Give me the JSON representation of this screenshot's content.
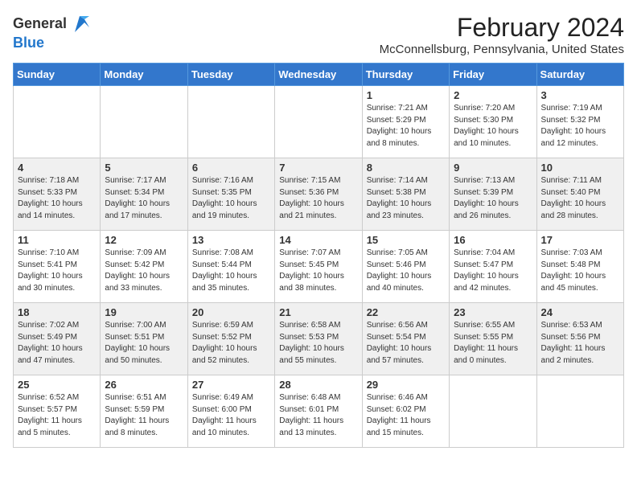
{
  "header": {
    "logo_general": "General",
    "logo_blue": "Blue",
    "month_title": "February 2024",
    "location": "McConnellsburg, Pennsylvania, United States"
  },
  "calendar": {
    "days_of_week": [
      "Sunday",
      "Monday",
      "Tuesday",
      "Wednesday",
      "Thursday",
      "Friday",
      "Saturday"
    ],
    "weeks": [
      [
        {
          "day": "",
          "info": ""
        },
        {
          "day": "",
          "info": ""
        },
        {
          "day": "",
          "info": ""
        },
        {
          "day": "",
          "info": ""
        },
        {
          "day": "1",
          "info": "Sunrise: 7:21 AM\nSunset: 5:29 PM\nDaylight: 10 hours\nand 8 minutes."
        },
        {
          "day": "2",
          "info": "Sunrise: 7:20 AM\nSunset: 5:30 PM\nDaylight: 10 hours\nand 10 minutes."
        },
        {
          "day": "3",
          "info": "Sunrise: 7:19 AM\nSunset: 5:32 PM\nDaylight: 10 hours\nand 12 minutes."
        }
      ],
      [
        {
          "day": "4",
          "info": "Sunrise: 7:18 AM\nSunset: 5:33 PM\nDaylight: 10 hours\nand 14 minutes."
        },
        {
          "day": "5",
          "info": "Sunrise: 7:17 AM\nSunset: 5:34 PM\nDaylight: 10 hours\nand 17 minutes."
        },
        {
          "day": "6",
          "info": "Sunrise: 7:16 AM\nSunset: 5:35 PM\nDaylight: 10 hours\nand 19 minutes."
        },
        {
          "day": "7",
          "info": "Sunrise: 7:15 AM\nSunset: 5:36 PM\nDaylight: 10 hours\nand 21 minutes."
        },
        {
          "day": "8",
          "info": "Sunrise: 7:14 AM\nSunset: 5:38 PM\nDaylight: 10 hours\nand 23 minutes."
        },
        {
          "day": "9",
          "info": "Sunrise: 7:13 AM\nSunset: 5:39 PM\nDaylight: 10 hours\nand 26 minutes."
        },
        {
          "day": "10",
          "info": "Sunrise: 7:11 AM\nSunset: 5:40 PM\nDaylight: 10 hours\nand 28 minutes."
        }
      ],
      [
        {
          "day": "11",
          "info": "Sunrise: 7:10 AM\nSunset: 5:41 PM\nDaylight: 10 hours\nand 30 minutes."
        },
        {
          "day": "12",
          "info": "Sunrise: 7:09 AM\nSunset: 5:42 PM\nDaylight: 10 hours\nand 33 minutes."
        },
        {
          "day": "13",
          "info": "Sunrise: 7:08 AM\nSunset: 5:44 PM\nDaylight: 10 hours\nand 35 minutes."
        },
        {
          "day": "14",
          "info": "Sunrise: 7:07 AM\nSunset: 5:45 PM\nDaylight: 10 hours\nand 38 minutes."
        },
        {
          "day": "15",
          "info": "Sunrise: 7:05 AM\nSunset: 5:46 PM\nDaylight: 10 hours\nand 40 minutes."
        },
        {
          "day": "16",
          "info": "Sunrise: 7:04 AM\nSunset: 5:47 PM\nDaylight: 10 hours\nand 42 minutes."
        },
        {
          "day": "17",
          "info": "Sunrise: 7:03 AM\nSunset: 5:48 PM\nDaylight: 10 hours\nand 45 minutes."
        }
      ],
      [
        {
          "day": "18",
          "info": "Sunrise: 7:02 AM\nSunset: 5:49 PM\nDaylight: 10 hours\nand 47 minutes."
        },
        {
          "day": "19",
          "info": "Sunrise: 7:00 AM\nSunset: 5:51 PM\nDaylight: 10 hours\nand 50 minutes."
        },
        {
          "day": "20",
          "info": "Sunrise: 6:59 AM\nSunset: 5:52 PM\nDaylight: 10 hours\nand 52 minutes."
        },
        {
          "day": "21",
          "info": "Sunrise: 6:58 AM\nSunset: 5:53 PM\nDaylight: 10 hours\nand 55 minutes."
        },
        {
          "day": "22",
          "info": "Sunrise: 6:56 AM\nSunset: 5:54 PM\nDaylight: 10 hours\nand 57 minutes."
        },
        {
          "day": "23",
          "info": "Sunrise: 6:55 AM\nSunset: 5:55 PM\nDaylight: 11 hours\nand 0 minutes."
        },
        {
          "day": "24",
          "info": "Sunrise: 6:53 AM\nSunset: 5:56 PM\nDaylight: 11 hours\nand 2 minutes."
        }
      ],
      [
        {
          "day": "25",
          "info": "Sunrise: 6:52 AM\nSunset: 5:57 PM\nDaylight: 11 hours\nand 5 minutes."
        },
        {
          "day": "26",
          "info": "Sunrise: 6:51 AM\nSunset: 5:59 PM\nDaylight: 11 hours\nand 8 minutes."
        },
        {
          "day": "27",
          "info": "Sunrise: 6:49 AM\nSunset: 6:00 PM\nDaylight: 11 hours\nand 10 minutes."
        },
        {
          "day": "28",
          "info": "Sunrise: 6:48 AM\nSunset: 6:01 PM\nDaylight: 11 hours\nand 13 minutes."
        },
        {
          "day": "29",
          "info": "Sunrise: 6:46 AM\nSunset: 6:02 PM\nDaylight: 11 hours\nand 15 minutes."
        },
        {
          "day": "",
          "info": ""
        },
        {
          "day": "",
          "info": ""
        }
      ]
    ]
  }
}
